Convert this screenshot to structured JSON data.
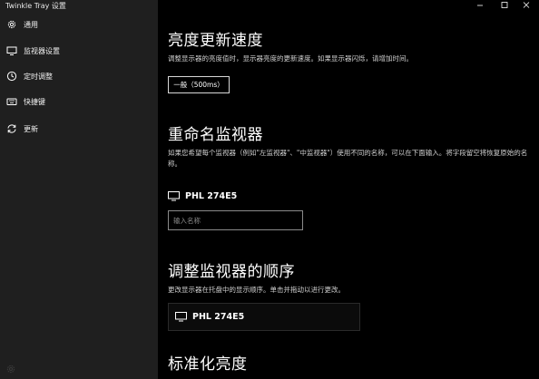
{
  "app": {
    "title": "Twinkle Tray 设置"
  },
  "sidebar": {
    "items": [
      {
        "label": "通用",
        "icon": "gear-icon"
      },
      {
        "label": "监视器设置",
        "icon": "monitor-icon"
      },
      {
        "label": "定时调整",
        "icon": "clock-icon"
      },
      {
        "label": "快捷键",
        "icon": "keyboard-icon"
      },
      {
        "label": "更新",
        "icon": "refresh-icon"
      }
    ]
  },
  "titlebar": {
    "minimize": "—",
    "maximize": "☐",
    "close": "✕"
  },
  "sections": {
    "brightness_speed": {
      "title": "亮度更新速度",
      "description": "调整显示器的亮度值时，显示器亮度的更新速度。如果显示器闪烁，请增加时间。",
      "button_label": "一般（500ms）"
    },
    "rename": {
      "title": "重命名监视器",
      "description": "如果您希望每个监视器（例如\"左监视器\"、\"中监视器\"）使用不同的名称，可以在下面输入。将字段留空将恢复原始的名称。",
      "monitor_name": "PHL 274E5",
      "input_placeholder": "输入名称",
      "input_value": ""
    },
    "order": {
      "title": "调整监视器的顺序",
      "description": "更改显示器在托盘中的显示顺序。单击并拖动以进行更改。",
      "monitor_name": "PHL 274E5"
    },
    "normalize": {
      "title": "标准化亮度"
    }
  }
}
